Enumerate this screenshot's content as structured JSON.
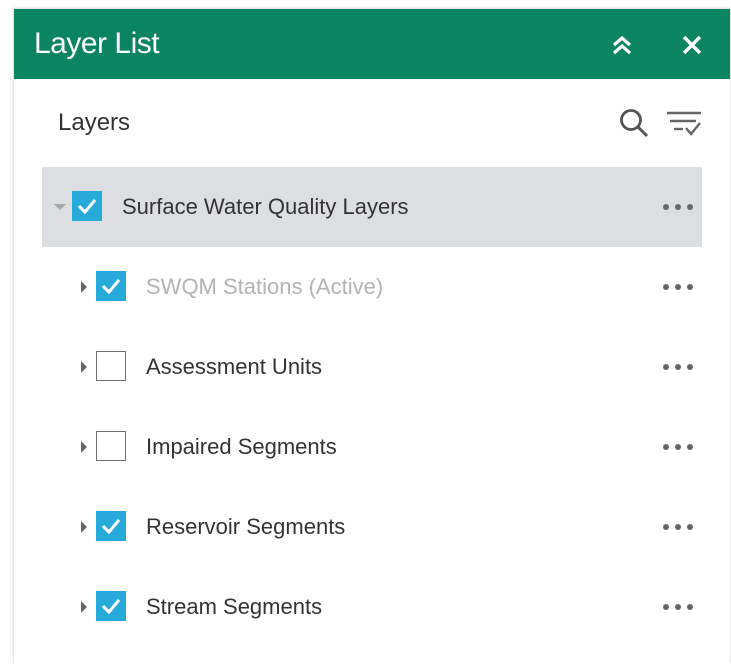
{
  "panel": {
    "title": "Layer List",
    "header_color": "#0b8461"
  },
  "section": {
    "label": "Layers"
  },
  "layers": [
    {
      "name": "Surface Water Quality Layers",
      "level": 0,
      "expanded": true,
      "checked": true,
      "dimmed": false,
      "selected": true
    },
    {
      "name": "SWQM Stations (Active)",
      "level": 1,
      "expanded": false,
      "checked": true,
      "dimmed": true,
      "selected": false
    },
    {
      "name": "Assessment Units",
      "level": 1,
      "expanded": false,
      "checked": false,
      "dimmed": false,
      "selected": false
    },
    {
      "name": "Impaired Segments",
      "level": 1,
      "expanded": false,
      "checked": false,
      "dimmed": false,
      "selected": false
    },
    {
      "name": "Reservoir Segments",
      "level": 1,
      "expanded": false,
      "checked": true,
      "dimmed": false,
      "selected": false
    },
    {
      "name": "Stream Segments",
      "level": 1,
      "expanded": false,
      "checked": true,
      "dimmed": false,
      "selected": false
    }
  ],
  "colors": {
    "checkbox_checked": "#27a9da",
    "selected_row": "#dcdee1"
  },
  "icons": {
    "collapse": "double-chevron-up-icon",
    "close": "close-icon",
    "search": "search-icon",
    "filter": "filter-list-icon",
    "more": "more-options-icon"
  }
}
